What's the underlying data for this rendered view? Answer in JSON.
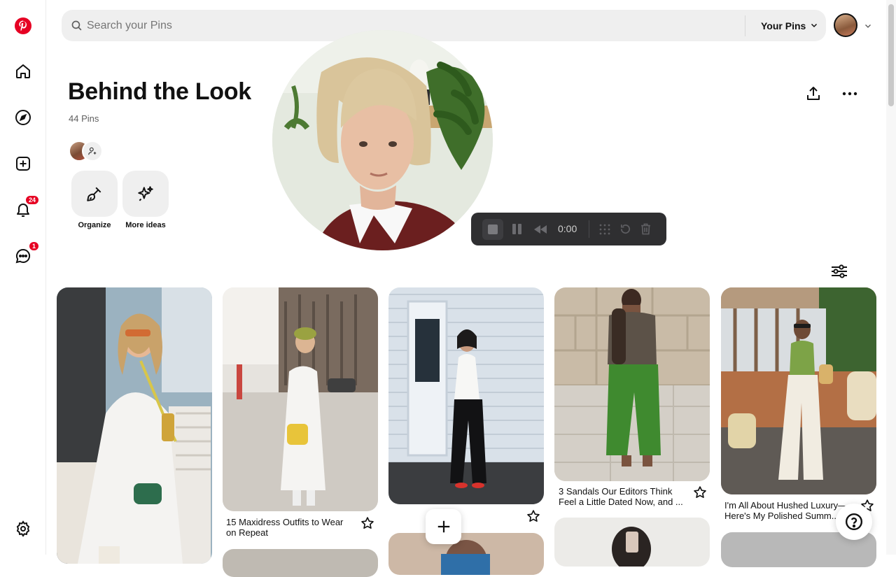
{
  "search": {
    "placeholder": "Search your Pins"
  },
  "header": {
    "your_pins_label": "Your Pins"
  },
  "board": {
    "title": "Behind the Look",
    "pin_count": "44 Pins"
  },
  "actions": {
    "organize_label": "Organize",
    "more_ideas_label": "More ideas"
  },
  "sidebar": {
    "notifications_badge": "24",
    "messages_badge": "1"
  },
  "recorder": {
    "time": "0:00"
  },
  "pins": [
    {
      "title": ""
    },
    {
      "title": "15 Maxidress Outfits to Wear on Repeat"
    },
    {
      "title": ""
    },
    {
      "title": "3 Sandals Our Editors Think Feel a Little Dated Now, and ..."
    },
    {
      "title": "I'm All About Hushed Luxury—Here's My Polished Summ..."
    }
  ],
  "colors": {
    "brand": "#e60023",
    "recorder_bg": "#2f2f31",
    "chip_bg": "#efefef"
  },
  "icons": [
    "pinterest-logo-icon",
    "home-icon",
    "compass-icon",
    "create-icon",
    "bell-icon",
    "chat-icon",
    "settings-icon",
    "search-icon",
    "chevron-down-icon",
    "share-icon",
    "more-icon",
    "organize-icon",
    "sparkle-icon",
    "add-collaborator-icon",
    "filter-icon",
    "star-icon",
    "plus-icon",
    "help-icon"
  ]
}
